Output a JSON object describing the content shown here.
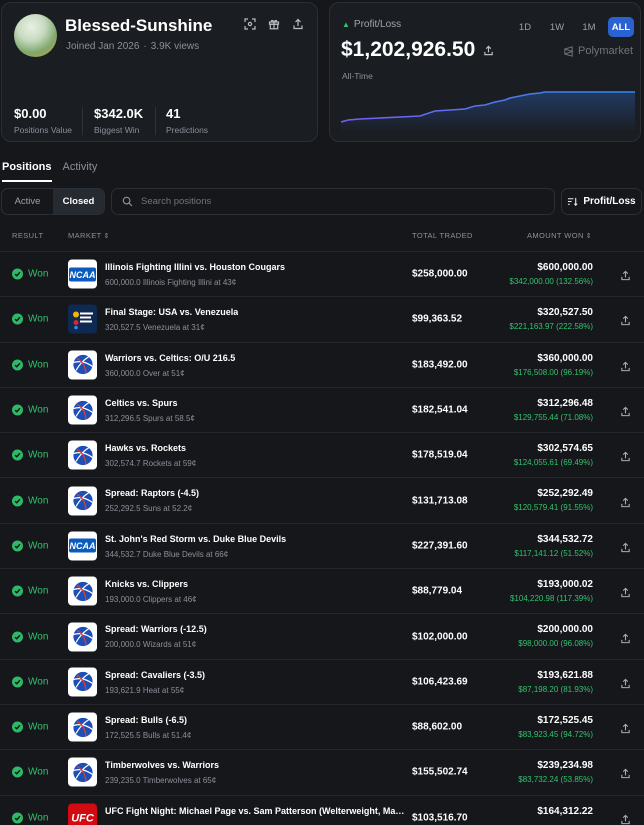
{
  "profile": {
    "name": "Blessed-Sunshine",
    "joined": "Joined Jan 2026",
    "views": "3.9K views",
    "stats": [
      {
        "value": "$0.00",
        "label": "Positions Value"
      },
      {
        "value": "$342.0K",
        "label": "Biggest Win"
      },
      {
        "value": "41",
        "label": "Predictions"
      }
    ]
  },
  "pnl": {
    "label": "Profit/Loss",
    "value": "$1,202,926.50",
    "period": "All-Time",
    "ranges": [
      "1D",
      "1W",
      "1M",
      "ALL"
    ],
    "active_range": "ALL",
    "brand": "Polymarket",
    "chart_color": "#7b5cf0",
    "chart_color_end": "#2f8bef"
  },
  "tabs": [
    "Positions",
    "Activity"
  ],
  "filters": {
    "active": "Active",
    "closed": "Closed"
  },
  "search": {
    "placeholder": "Search positions"
  },
  "sort_button": "Profit/Loss",
  "columns": {
    "result": "RESULT",
    "market": "MARKET",
    "traded": "TOTAL TRADED",
    "won": "AMOUNT WON"
  },
  "colors": {
    "win": "#32c36c",
    "accent": "#2b62d1"
  },
  "positions": [
    {
      "result": "Won",
      "logo": "ncaa",
      "title": "Illinois Fighting Illini vs. Houston Cougars",
      "sub": "600,000.0 Illinois Fighting Illini at 43¢",
      "traded": "$258,000.00",
      "amount": "$600,000.00",
      "pnl": "$342,000.00 (132.56%)"
    },
    {
      "result": "Won",
      "logo": "wbc",
      "title": "Final Stage: USA vs. Venezuela",
      "sub": "320,527.5 Venezuela at 31¢",
      "traded": "$99,363.52",
      "amount": "$320,527.50",
      "pnl": "$221,163.97 (222.58%)"
    },
    {
      "result": "Won",
      "logo": "nba",
      "title": "Warriors vs. Celtics: O/U 216.5",
      "sub": "360,000.0 Over at 51¢",
      "traded": "$183,492.00",
      "amount": "$360,000.00",
      "pnl": "$176,508.00 (96.19%)"
    },
    {
      "result": "Won",
      "logo": "nba",
      "title": "Celtics vs. Spurs",
      "sub": "312,296.5 Spurs at 58.5¢",
      "traded": "$182,541.04",
      "amount": "$312,296.48",
      "pnl": "$129,755.44 (71.08%)"
    },
    {
      "result": "Won",
      "logo": "nba",
      "title": "Hawks vs. Rockets",
      "sub": "302,574.7 Rockets at 59¢",
      "traded": "$178,519.04",
      "amount": "$302,574.65",
      "pnl": "$124,055.61 (69.49%)"
    },
    {
      "result": "Won",
      "logo": "nba",
      "title": "Spread: Raptors (-4.5)",
      "sub": "252,292.5 Suns at 52.2¢",
      "traded": "$131,713.08",
      "amount": "$252,292.49",
      "pnl": "$120,579.41 (91.55%)"
    },
    {
      "result": "Won",
      "logo": "ncaa",
      "title": "St. John's Red Storm vs. Duke Blue Devils",
      "sub": "344,532.7 Duke Blue Devils at 66¢",
      "traded": "$227,391.60",
      "amount": "$344,532.72",
      "pnl": "$117,141.12 (51.52%)"
    },
    {
      "result": "Won",
      "logo": "nba",
      "title": "Knicks vs. Clippers",
      "sub": "193,000.0 Clippers at 46¢",
      "traded": "$88,779.04",
      "amount": "$193,000.02",
      "pnl": "$104,220.98 (117.39%)"
    },
    {
      "result": "Won",
      "logo": "nba",
      "title": "Spread: Warriors (-12.5)",
      "sub": "200,000.0 Wizards at 51¢",
      "traded": "$102,000.00",
      "amount": "$200,000.00",
      "pnl": "$98,000.00 (96.08%)"
    },
    {
      "result": "Won",
      "logo": "nba",
      "title": "Spread: Cavaliers (-3.5)",
      "sub": "193,621.9 Heat at 55¢",
      "traded": "$106,423.69",
      "amount": "$193,621.88",
      "pnl": "$87,198.20 (81.93%)"
    },
    {
      "result": "Won",
      "logo": "nba",
      "title": "Spread: Bulls (-6.5)",
      "sub": "172,525.5 Bulls at 51.4¢",
      "traded": "$88,602.00",
      "amount": "$172,525.45",
      "pnl": "$83,923.45 (94.72%)"
    },
    {
      "result": "Won",
      "logo": "nba",
      "title": "Timberwolves vs. Warriors",
      "sub": "239,235.0 Timberwolves at 65¢",
      "traded": "$155,502.74",
      "amount": "$239,234.98",
      "pnl": "$83,732.24 (53.85%)"
    },
    {
      "result": "Won",
      "logo": "ufc",
      "title": "UFC Fight Night: Michael Page vs. Sam Patterson (Welterweight, Main Card)",
      "sub": "",
      "traded": "$103,516.70",
      "amount": "$164,312.22",
      "pnl": ""
    }
  ]
}
